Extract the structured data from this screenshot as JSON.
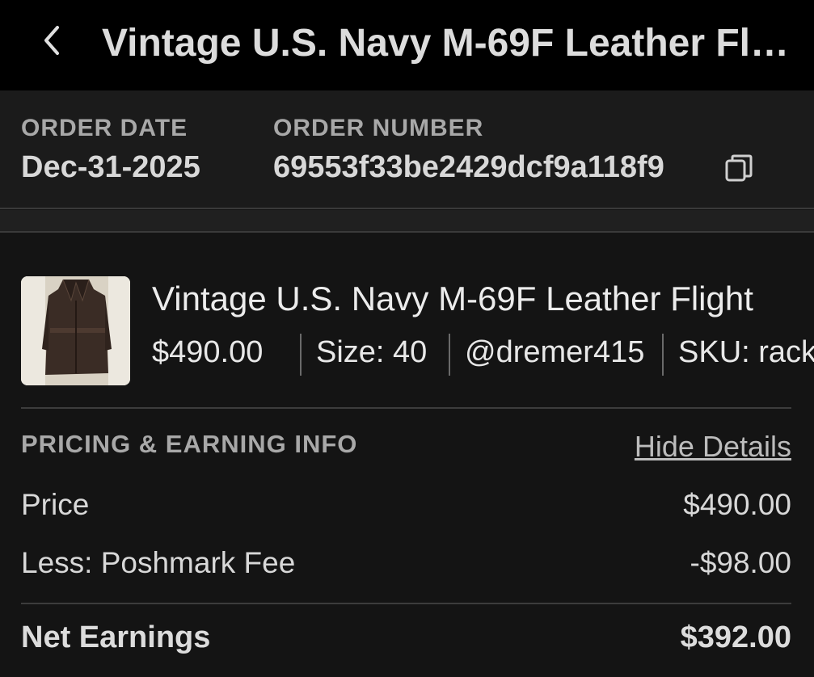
{
  "header": {
    "title": "Vintage U.S. Navy M-69F Leather Fli…",
    "back_icon": "chevron-left-icon"
  },
  "order": {
    "date_label": "ORDER DATE",
    "date_value": "Dec-31-2025",
    "number_label": "ORDER NUMBER",
    "number_value": "69553f33be2429dcf9a118f9",
    "copy_icon": "copy-icon"
  },
  "item": {
    "title": "Vintage U.S. Navy M-69F Leather Flight",
    "price": "$490.00",
    "size": "Size: 40",
    "seller": "@dremer415",
    "sku": "SKU: rack"
  },
  "pricing": {
    "section_label": "PRICING & EARNING INFO",
    "toggle_label": "Hide Details",
    "rows": [
      {
        "label": "Price",
        "value": "$490.00"
      },
      {
        "label": "Less: Poshmark Fee",
        "value": "-$98.00"
      }
    ],
    "net_label": "Net Earnings",
    "net_value": "$392.00"
  },
  "colors": {
    "background": "#141414",
    "header_background": "#000000",
    "band_background": "#1b1b1b",
    "label_gray": "#a8a8a8",
    "text": "#e6e6e6"
  }
}
